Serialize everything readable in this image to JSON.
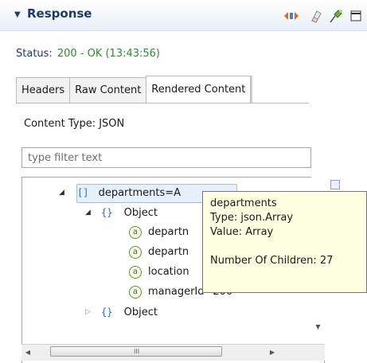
{
  "header": {
    "title": "Response",
    "icons": [
      "navigate-icon",
      "clear-icon",
      "pin-icon",
      "maximize-icon"
    ]
  },
  "status": {
    "label": "Status:",
    "value": "200 - OK (13:43:56)"
  },
  "tabs": [
    {
      "label": "Headers",
      "active": false
    },
    {
      "label": "Raw Content",
      "active": false
    },
    {
      "label": "Rendered Content",
      "active": true
    }
  ],
  "content_type": "Content Type: JSON",
  "filter": {
    "placeholder": "type filter text",
    "value": ""
  },
  "tree": {
    "rows": [
      {
        "type": "array",
        "glyph": "[]",
        "label": "departments=A"
      },
      {
        "type": "object",
        "glyph": "{}",
        "label": "Object"
      },
      {
        "type": "attr",
        "glyph": "a",
        "label": "departn"
      },
      {
        "type": "attr",
        "glyph": "a",
        "label": "departn"
      },
      {
        "type": "attr",
        "glyph": "a",
        "label": "location"
      },
      {
        "type": "attr",
        "glyph": "a",
        "label": "managerId=200"
      },
      {
        "type": "object",
        "glyph": "{}",
        "label": "Object"
      }
    ]
  },
  "tooltip": {
    "name": "departments",
    "type": "Type: json.Array",
    "value": "Value: Array",
    "children": "Number Of Children: 27"
  },
  "scrollbar": {
    "grip": "III"
  },
  "colors": {
    "header_text": "#1f3b68",
    "status_ok": "#2e8b2e",
    "tooltip_bg": "#ffffe1"
  }
}
